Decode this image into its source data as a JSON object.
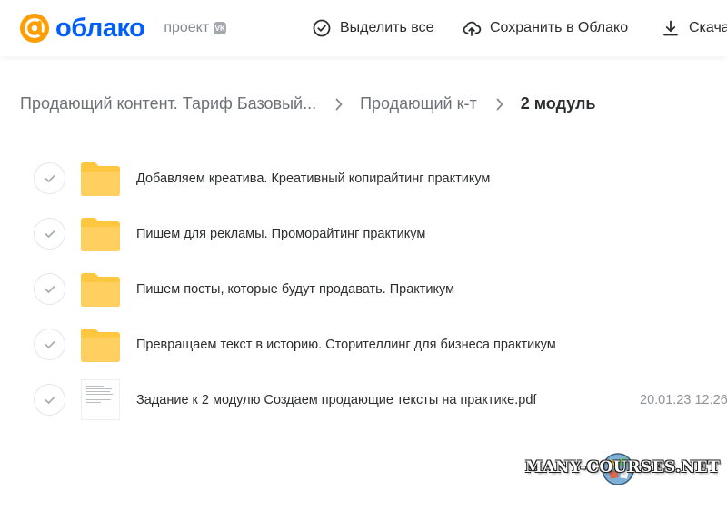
{
  "header": {
    "logo_text": "облако",
    "project_label": "проект",
    "vk_badge": "VK",
    "select_all": "Выделить все",
    "save_to_cloud": "Сохранить в Облако",
    "download": "Скачать"
  },
  "breadcrumb": {
    "items": [
      "Продающий контент. Тариф Базовый...",
      "Продающий к-т"
    ],
    "current": "2 модуль"
  },
  "files": [
    {
      "type": "folder",
      "name": "Добавляем креатива. Креативный копирайтинг практикум",
      "date": ""
    },
    {
      "type": "folder",
      "name": "Пишем для рекламы. Проморайтинг практикум",
      "date": ""
    },
    {
      "type": "folder",
      "name": "Пишем посты, которые будут продавать. Практикум",
      "date": ""
    },
    {
      "type": "folder",
      "name": "Превращаем текст в историю. Сторителлинг для бизнеса практикум",
      "date": ""
    },
    {
      "type": "pdf",
      "name": "Задание к 2 модулю Создаем продающие тексты на практике.pdf",
      "date": "20.01.23 12:26"
    }
  ],
  "watermark": "MANY-COURSES.NET",
  "colors": {
    "brand_orange": "#ff9e00",
    "brand_blue": "#005ff9",
    "folder": "#ffc640",
    "text": "#2c2d2e",
    "muted": "#6e7077"
  },
  "icons": {
    "logo": "at-sign-icon",
    "select_all": "check-circle-icon",
    "save": "cloud-upload-icon",
    "download": "download-icon",
    "separator": "chevron-right-icon",
    "folder": "folder-icon",
    "pdf": "pdf-thumbnail-icon"
  }
}
